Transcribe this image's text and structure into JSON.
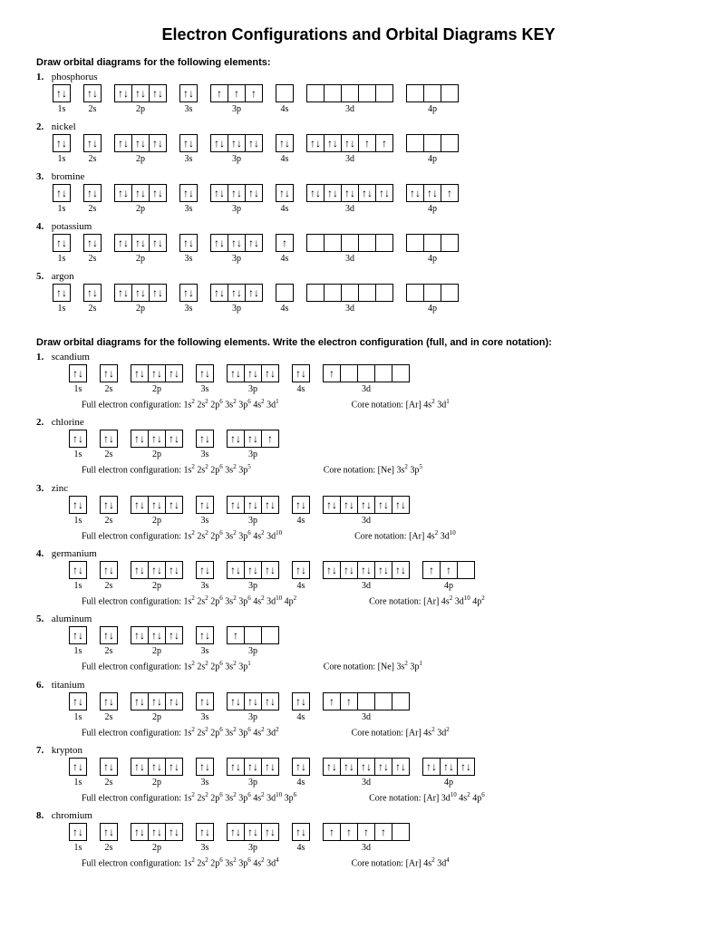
{
  "title": "Electron Configurations and Orbital Diagrams KEY",
  "section1": {
    "header": "Draw orbital diagrams for the following elements:",
    "problems": [
      {
        "num": "1.",
        "name": "phosphorus",
        "sublevels": [
          {
            "label": "1s",
            "boxes": [
              "↑↓"
            ]
          },
          {
            "label": "2s",
            "boxes": [
              "↑↓"
            ]
          },
          {
            "label": "2p",
            "boxes": [
              "↑↓",
              "↑↓",
              "↑↓"
            ]
          },
          {
            "label": "3s",
            "boxes": [
              "↑↓"
            ]
          },
          {
            "label": "3p",
            "boxes": [
              "↑",
              "↑",
              "↑"
            ]
          },
          {
            "label": "4s",
            "boxes": [
              ""
            ]
          },
          {
            "label": "3d",
            "boxes": [
              "",
              "",
              "",
              "",
              ""
            ]
          },
          {
            "label": "4p",
            "boxes": [
              "",
              "",
              ""
            ]
          }
        ]
      },
      {
        "num": "2.",
        "name": "nickel",
        "sublevels": [
          {
            "label": "1s",
            "boxes": [
              "↑↓"
            ]
          },
          {
            "label": "2s",
            "boxes": [
              "↑↓"
            ]
          },
          {
            "label": "2p",
            "boxes": [
              "↑↓",
              "↑↓",
              "↑↓"
            ]
          },
          {
            "label": "3s",
            "boxes": [
              "↑↓"
            ]
          },
          {
            "label": "3p",
            "boxes": [
              "↑↓",
              "↑↓",
              "↑↓"
            ]
          },
          {
            "label": "4s",
            "boxes": [
              "↑↓"
            ]
          },
          {
            "label": "3d",
            "boxes": [
              "↑↓",
              "↑↓",
              "↑↓",
              "↑",
              "↑"
            ]
          },
          {
            "label": "4p",
            "boxes": [
              "",
              "",
              ""
            ]
          }
        ]
      },
      {
        "num": "3.",
        "name": "bromine",
        "sublevels": [
          {
            "label": "1s",
            "boxes": [
              "↑↓"
            ]
          },
          {
            "label": "2s",
            "boxes": [
              "↑↓"
            ]
          },
          {
            "label": "2p",
            "boxes": [
              "↑↓",
              "↑↓",
              "↑↓"
            ]
          },
          {
            "label": "3s",
            "boxes": [
              "↑↓"
            ]
          },
          {
            "label": "3p",
            "boxes": [
              "↑↓",
              "↑↓",
              "↑↓"
            ]
          },
          {
            "label": "4s",
            "boxes": [
              "↑↓"
            ]
          },
          {
            "label": "3d",
            "boxes": [
              "↑↓",
              "↑↓",
              "↑↓",
              "↑↓",
              "↑↓"
            ]
          },
          {
            "label": "4p",
            "boxes": [
              "↑↓",
              "↑↓",
              "↑"
            ]
          }
        ]
      },
      {
        "num": "4.",
        "name": "potassium",
        "sublevels": [
          {
            "label": "1s",
            "boxes": [
              "↑↓"
            ]
          },
          {
            "label": "2s",
            "boxes": [
              "↑↓"
            ]
          },
          {
            "label": "2p",
            "boxes": [
              "↑↓",
              "↑↓",
              "↑↓"
            ]
          },
          {
            "label": "3s",
            "boxes": [
              "↑↓"
            ]
          },
          {
            "label": "3p",
            "boxes": [
              "↑↓",
              "↑↓",
              "↑↓"
            ]
          },
          {
            "label": "4s",
            "boxes": [
              "↑"
            ]
          },
          {
            "label": "3d",
            "boxes": [
              "",
              "",
              "",
              "",
              ""
            ]
          },
          {
            "label": "4p",
            "boxes": [
              "",
              "",
              ""
            ]
          }
        ]
      },
      {
        "num": "5.",
        "name": "argon",
        "sublevels": [
          {
            "label": "1s",
            "boxes": [
              "↑↓"
            ]
          },
          {
            "label": "2s",
            "boxes": [
              "↑↓"
            ]
          },
          {
            "label": "2p",
            "boxes": [
              "↑↓",
              "↑↓",
              "↑↓"
            ]
          },
          {
            "label": "3s",
            "boxes": [
              "↑↓"
            ]
          },
          {
            "label": "3p",
            "boxes": [
              "↑↓",
              "↑↓",
              "↑↓"
            ]
          },
          {
            "label": "4s",
            "boxes": [
              ""
            ]
          },
          {
            "label": "3d",
            "boxes": [
              "",
              "",
              "",
              "",
              ""
            ]
          },
          {
            "label": "4p",
            "boxes": [
              "",
              "",
              ""
            ]
          }
        ]
      }
    ]
  },
  "section2": {
    "header": "Draw orbital diagrams for the following elements.  Write the electron configuration (full, and in core notation):",
    "full_label": "Full electron configuration:",
    "core_label": "Core notation:",
    "problems": [
      {
        "num": "1.",
        "name": "scandium",
        "sublevels": [
          {
            "label": "1s",
            "boxes": [
              "↑↓"
            ]
          },
          {
            "label": "2s",
            "boxes": [
              "↑↓"
            ]
          },
          {
            "label": "2p",
            "boxes": [
              "↑↓",
              "↑↓",
              "↑↓"
            ]
          },
          {
            "label": "3s",
            "boxes": [
              "↑↓"
            ]
          },
          {
            "label": "3p",
            "boxes": [
              "↑↓",
              "↑↓",
              "↑↓"
            ]
          },
          {
            "label": "4s",
            "boxes": [
              "↑↓"
            ]
          },
          {
            "label": "3d",
            "boxes": [
              "↑",
              "",
              "",
              "",
              ""
            ]
          }
        ],
        "full": "1s<sup>2</sup> 2s<sup>2</sup> 2p<sup>6</sup> 3s<sup>2</sup> 3p<sup>6</sup> 4s<sup>2</sup> 3d<sup>1</sup>",
        "core": "[Ar] 4s<sup>2</sup> 3d<sup>1</sup>"
      },
      {
        "num": "2.",
        "name": "chlorine",
        "sublevels": [
          {
            "label": "1s",
            "boxes": [
              "↑↓"
            ]
          },
          {
            "label": "2s",
            "boxes": [
              "↑↓"
            ]
          },
          {
            "label": "2p",
            "boxes": [
              "↑↓",
              "↑↓",
              "↑↓"
            ]
          },
          {
            "label": "3s",
            "boxes": [
              "↑↓"
            ]
          },
          {
            "label": "3p",
            "boxes": [
              "↑↓",
              "↑↓",
              "↑"
            ]
          }
        ],
        "full": "1s<sup>2</sup> 2s<sup>2</sup> 2p<sup>6</sup> 3s<sup>2</sup> 3p<sup>5</sup>",
        "core": "[Ne] 3s<sup>2</sup> 3p<sup>5</sup>"
      },
      {
        "num": "3.",
        "name": "zinc",
        "sublevels": [
          {
            "label": "1s",
            "boxes": [
              "↑↓"
            ]
          },
          {
            "label": "2s",
            "boxes": [
              "↑↓"
            ]
          },
          {
            "label": "2p",
            "boxes": [
              "↑↓",
              "↑↓",
              "↑↓"
            ]
          },
          {
            "label": "3s",
            "boxes": [
              "↑↓"
            ]
          },
          {
            "label": "3p",
            "boxes": [
              "↑↓",
              "↑↓",
              "↑↓"
            ]
          },
          {
            "label": "4s",
            "boxes": [
              "↑↓"
            ]
          },
          {
            "label": "3d",
            "boxes": [
              "↑↓",
              "↑↓",
              "↑↓",
              "↑↓",
              "↑↓"
            ]
          }
        ],
        "full": "1s<sup>2</sup> 2s<sup>2</sup> 2p<sup>6</sup> 3s<sup>2</sup> 3p<sup>6</sup> 4s<sup>2</sup> 3d<sup>10</sup>",
        "core": "[Ar] 4s<sup>2</sup> 3d<sup>10</sup>"
      },
      {
        "num": "4.",
        "name": "germanium",
        "sublevels": [
          {
            "label": "1s",
            "boxes": [
              "↑↓"
            ]
          },
          {
            "label": "2s",
            "boxes": [
              "↑↓"
            ]
          },
          {
            "label": "2p",
            "boxes": [
              "↑↓",
              "↑↓",
              "↑↓"
            ]
          },
          {
            "label": "3s",
            "boxes": [
              "↑↓"
            ]
          },
          {
            "label": "3p",
            "boxes": [
              "↑↓",
              "↑↓",
              "↑↓"
            ]
          },
          {
            "label": "4s",
            "boxes": [
              "↑↓"
            ]
          },
          {
            "label": "3d",
            "boxes": [
              "↑↓",
              "↑↓",
              "↑↓",
              "↑↓",
              "↑↓"
            ]
          },
          {
            "label": "4p",
            "boxes": [
              "↑",
              "↑",
              ""
            ]
          }
        ],
        "full": "1s<sup>2</sup> 2s<sup>2</sup> 2p<sup>6</sup> 3s<sup>2</sup> 3p<sup>6</sup> 4s<sup>2</sup> 3d<sup>10</sup> 4p<sup>2</sup>",
        "core": "[Ar] 4s<sup>2</sup> 3d<sup>10</sup> 4p<sup>2</sup>"
      },
      {
        "num": "5.",
        "name": "aluminum",
        "sublevels": [
          {
            "label": "1s",
            "boxes": [
              "↑↓"
            ]
          },
          {
            "label": "2s",
            "boxes": [
              "↑↓"
            ]
          },
          {
            "label": "2p",
            "boxes": [
              "↑↓",
              "↑↓",
              "↑↓"
            ]
          },
          {
            "label": "3s",
            "boxes": [
              "↑↓"
            ]
          },
          {
            "label": "3p",
            "boxes": [
              "↑",
              "",
              ""
            ]
          }
        ],
        "full": "1s<sup>2</sup> 2s<sup>2</sup> 2p<sup>6</sup> 3s<sup>2</sup> 3p<sup>1</sup>",
        "core": "[Ne] 3s<sup>2</sup> 3p<sup>1</sup>"
      },
      {
        "num": "6.",
        "name": "titanium",
        "sublevels": [
          {
            "label": "1s",
            "boxes": [
              "↑↓"
            ]
          },
          {
            "label": "2s",
            "boxes": [
              "↑↓"
            ]
          },
          {
            "label": "2p",
            "boxes": [
              "↑↓",
              "↑↓",
              "↑↓"
            ]
          },
          {
            "label": "3s",
            "boxes": [
              "↑↓"
            ]
          },
          {
            "label": "3p",
            "boxes": [
              "↑↓",
              "↑↓",
              "↑↓"
            ]
          },
          {
            "label": "4s",
            "boxes": [
              "↑↓"
            ]
          },
          {
            "label": "3d",
            "boxes": [
              "↑",
              "↑",
              "",
              "",
              ""
            ]
          }
        ],
        "full": "1s<sup>2</sup> 2s<sup>2</sup> 2p<sup>6</sup> 3s<sup>2</sup> 3p<sup>6</sup> 4s<sup>2</sup> 3d<sup>2</sup>",
        "core": "[Ar] 4s<sup>2</sup> 3d<sup>2</sup>"
      },
      {
        "num": "7.",
        "name": "krypton",
        "sublevels": [
          {
            "label": "1s",
            "boxes": [
              "↑↓"
            ]
          },
          {
            "label": "2s",
            "boxes": [
              "↑↓"
            ]
          },
          {
            "label": "2p",
            "boxes": [
              "↑↓",
              "↑↓",
              "↑↓"
            ]
          },
          {
            "label": "3s",
            "boxes": [
              "↑↓"
            ]
          },
          {
            "label": "3p",
            "boxes": [
              "↑↓",
              "↑↓",
              "↑↓"
            ]
          },
          {
            "label": "4s",
            "boxes": [
              "↑↓"
            ]
          },
          {
            "label": "3d",
            "boxes": [
              "↑↓",
              "↑↓",
              "↑↓",
              "↑↓",
              "↑↓"
            ]
          },
          {
            "label": "4p",
            "boxes": [
              "↑↓",
              "↑↓",
              "↑↓"
            ]
          }
        ],
        "full": "1s<sup>2</sup> 2s<sup>2</sup> 2p<sup>6</sup> 3s<sup>2</sup> 3p<sup>6</sup> 4s<sup>2</sup> 3d<sup>10</sup> 3p<sup>6</sup>",
        "core": "[Ar] 3d<sup>10</sup> 4s<sup>2</sup> 4p<sup>6</sup>"
      },
      {
        "num": "8.",
        "name": "chromium",
        "sublevels": [
          {
            "label": "1s",
            "boxes": [
              "↑↓"
            ]
          },
          {
            "label": "2s",
            "boxes": [
              "↑↓"
            ]
          },
          {
            "label": "2p",
            "boxes": [
              "↑↓",
              "↑↓",
              "↑↓"
            ]
          },
          {
            "label": "3s",
            "boxes": [
              "↑↓"
            ]
          },
          {
            "label": "3p",
            "boxes": [
              "↑↓",
              "↑↓",
              "↑↓"
            ]
          },
          {
            "label": "4s",
            "boxes": [
              "↑↓"
            ]
          },
          {
            "label": "3d",
            "boxes": [
              "↑",
              "↑",
              "↑",
              "↑",
              ""
            ]
          }
        ],
        "full": "1s<sup>2</sup> 2s<sup>2</sup> 2p<sup>6</sup> 3s<sup>2</sup> 3p<sup>6</sup> 4s<sup>2</sup> 3d<sup>4</sup>",
        "core": "[Ar] 4s<sup>2</sup> 3d<sup>4</sup>"
      }
    ]
  }
}
